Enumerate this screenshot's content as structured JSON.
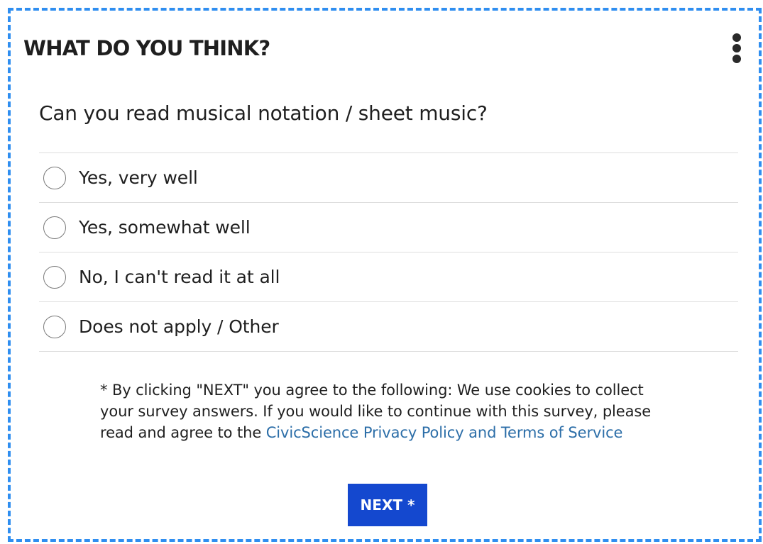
{
  "header": {
    "title": "WHAT DO YOU THINK?",
    "menu_icon": "more-vertical-icon"
  },
  "survey": {
    "question": "Can you read musical notation / sheet music?",
    "options": [
      {
        "label": "Yes, very well",
        "selected": false
      },
      {
        "label": "Yes, somewhat well",
        "selected": false
      },
      {
        "label": "No, I can't read it at all",
        "selected": false
      },
      {
        "label": "Does not apply / Other",
        "selected": false
      }
    ]
  },
  "disclaimer": {
    "text": "* By clicking \"NEXT\" you agree to the following: We use cookies to collect your survey answers. If you would like to continue with this survey, please read and agree to the ",
    "link_text": "CivicScience Privacy Policy and Terms of Service"
  },
  "actions": {
    "next_label": "NEXT *"
  },
  "colors": {
    "border_accent": "#2f8ef0",
    "button_bg": "#1448cf",
    "link": "#2c6ea8",
    "divider": "#dedede",
    "text": "#1f1f1f"
  }
}
